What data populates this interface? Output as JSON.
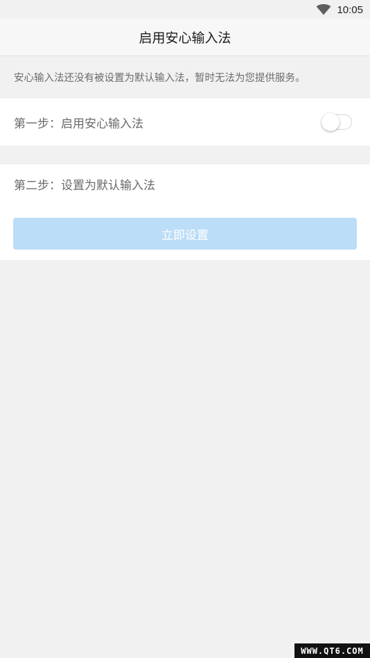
{
  "status_bar": {
    "time": "10:05",
    "wifi_icon": "wifi-icon"
  },
  "header": {
    "title": "启用安心输入法"
  },
  "notice": {
    "text": "安心输入法还没有被设置为默认输入法，暂时无法为您提供服务。"
  },
  "step1": {
    "label": "第一步：启用安心输入法",
    "toggle_on": false
  },
  "step2": {
    "label": "第二步：设置为默认输入法",
    "button_label": "立即设置",
    "button_color": "#bcddf7"
  },
  "watermark": {
    "text": "WWW.QT6.COM"
  },
  "colors": {
    "background": "#f1f1f1",
    "card": "#ffffff",
    "header": "#f7f7f7"
  }
}
